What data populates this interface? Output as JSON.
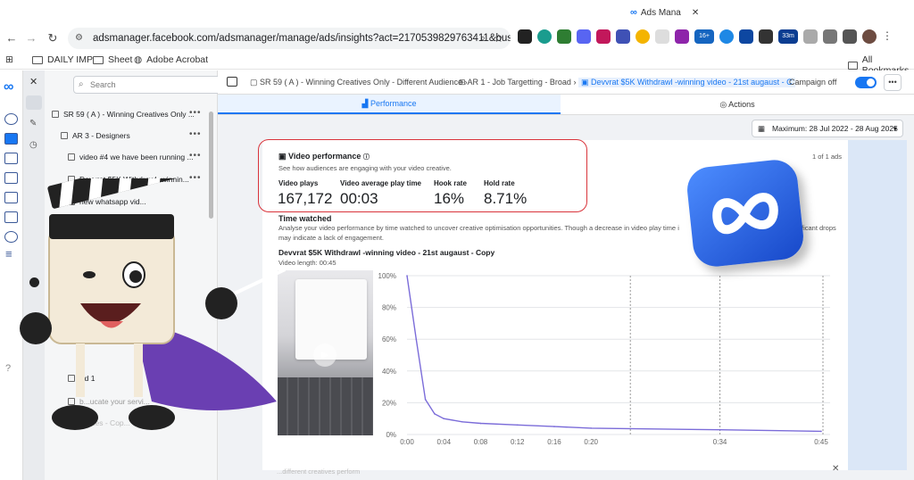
{
  "browser": {
    "tab_title": "Ads Mana",
    "url": "adsmanager.facebook.com/adsmanager/manage/ads/insights?act=2170539829763411&business_i...",
    "bookmarks": [
      "DAILY IMP",
      "Sheet",
      "Adobe Acrobat"
    ],
    "all_bookmarks": "All Bookmarks",
    "ext_badges": [
      "16+",
      "33m"
    ]
  },
  "sidebar": {
    "search_placeholder": "Search",
    "items": [
      {
        "label": "SR 59 ( A ) - Winning Creatives Only ..."
      },
      {
        "label": "AR 3 - Designers"
      },
      {
        "label": "video #4 we have been running ..."
      },
      {
        "label": "Devvrat $5K Withdrawl -winnin..."
      },
      {
        "label": "new whatsapp vid..."
      },
      {
        "label": "Ad 1"
      },
      {
        "label": "b...ucate your servi..."
      },
      {
        "label": "...ories - Cop..."
      }
    ]
  },
  "breadcrumb": {
    "c1": "SR 59 ( A ) - Winning Creatives Only - Different Audience",
    "c2": "AR 1 - Job Targetting - Broad",
    "c3": "Devvrat $5K Withdrawl -winning video - 21st augaust - C",
    "campaign_toggle": "Campaign off"
  },
  "tabs": {
    "performance": "Performance",
    "actions": "Actions"
  },
  "date_range": "Maximum: 28 Jul 2022 - 28 Aug 2025",
  "video_performance": {
    "title": "Video performance",
    "subtitle": "See how audiences are engaging with your video creative.",
    "counter": "1 of 1 ads",
    "metrics": [
      {
        "label": "Video plays",
        "value": "167,172"
      },
      {
        "label": "Video average play time",
        "value": "00:03"
      },
      {
        "label": "Hook rate",
        "value": "16%"
      },
      {
        "label": "Hold rate",
        "value": "8.71%"
      }
    ]
  },
  "time_watched": {
    "title": "Time watched",
    "desc": "Analyse your video performance by time watched to uncover creative optimisation opportunities. Though a decrease in video play time i",
    "desc_right": "ficant drops",
    "desc2": "may indicate a lack of engagement.",
    "video_title": "Devvrat $5K Withdrawl -winning video - 21st augaust - Copy",
    "video_length": "Video length: 00:45"
  },
  "footer_text": "...different creatives perform",
  "chart_data": {
    "type": "line",
    "x": [
      "0:00",
      "0:01",
      "0:02",
      "0:03",
      "0:04",
      "0:06",
      "0:08",
      "0:12",
      "0:16",
      "0:20",
      "0:34",
      "0:45"
    ],
    "series": [
      {
        "values": [
          100,
          60,
          22,
          13,
          10,
          8,
          7,
          6,
          5,
          4,
          3,
          2
        ]
      }
    ],
    "ylabels": [
      "100%",
      "80%",
      "60%",
      "40%",
      "20%",
      "0%"
    ],
    "xlabels": [
      "0:00",
      "0:04",
      "0:08",
      "0:12",
      "0:16",
      "0:20",
      "0:34",
      "0:45"
    ],
    "ylim": [
      0,
      100
    ],
    "color": "#7b6cd9"
  }
}
